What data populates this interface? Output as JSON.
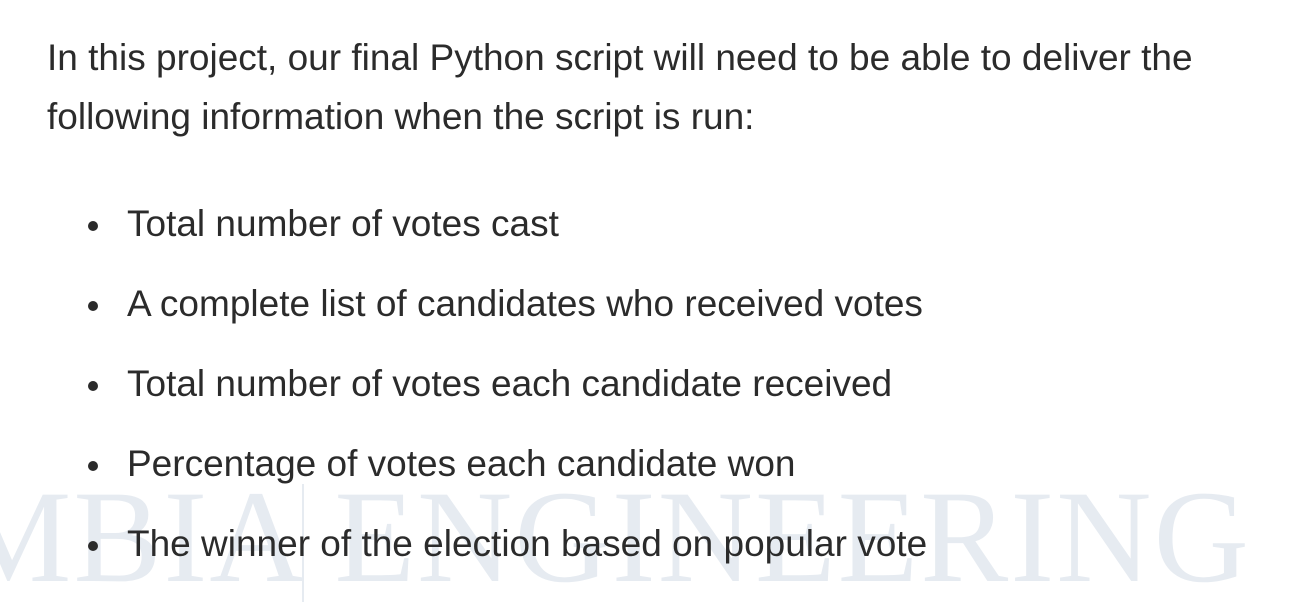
{
  "watermark": {
    "text": "MBIA  ENGINEERING",
    "color": "#e6ebf1"
  },
  "intro": {
    "text": "In this project, our final Python script will need to be able to deliver the following information when the script is run:"
  },
  "bullets": [
    {
      "text": "Total number of votes cast"
    },
    {
      "text": "A complete list of candidates who received votes"
    },
    {
      "text": "Total number of votes each candidate received"
    },
    {
      "text": "Percentage of votes each candidate won"
    },
    {
      "text": "The winner of the election based on popular vote"
    }
  ]
}
